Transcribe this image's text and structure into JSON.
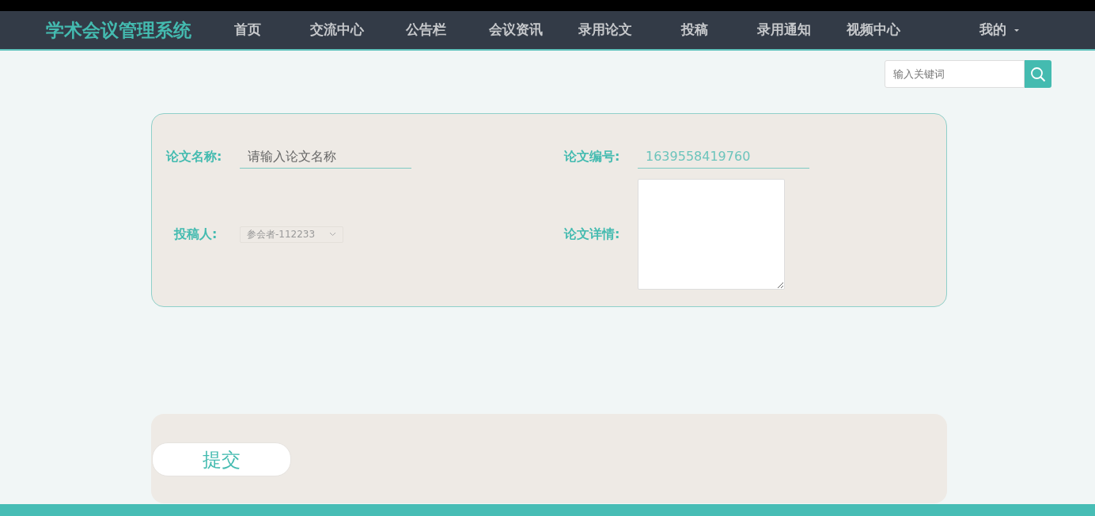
{
  "navbar": {
    "brand": "学术会议管理系统",
    "items": [
      {
        "label": "首页"
      },
      {
        "label": "交流中心"
      },
      {
        "label": "公告栏"
      },
      {
        "label": "会议资讯"
      },
      {
        "label": "录用论文"
      },
      {
        "label": "投稿"
      },
      {
        "label": "录用通知"
      },
      {
        "label": "视频中心"
      }
    ],
    "user_menu": {
      "label": "我的"
    }
  },
  "search": {
    "placeholder": "输入关键词"
  },
  "form": {
    "fields": [
      {
        "kind": "text",
        "label": "论文名称:",
        "placeholder": "请输入论文名称"
      },
      {
        "kind": "text",
        "label": "论文编号:",
        "value": "1639558419760"
      },
      {
        "kind": "select",
        "label": "投稿人:",
        "value": "参会者-112233",
        "disabled": true
      },
      {
        "kind": "textarea",
        "label": "论文详情:"
      }
    ]
  },
  "submit_button": "提交"
}
